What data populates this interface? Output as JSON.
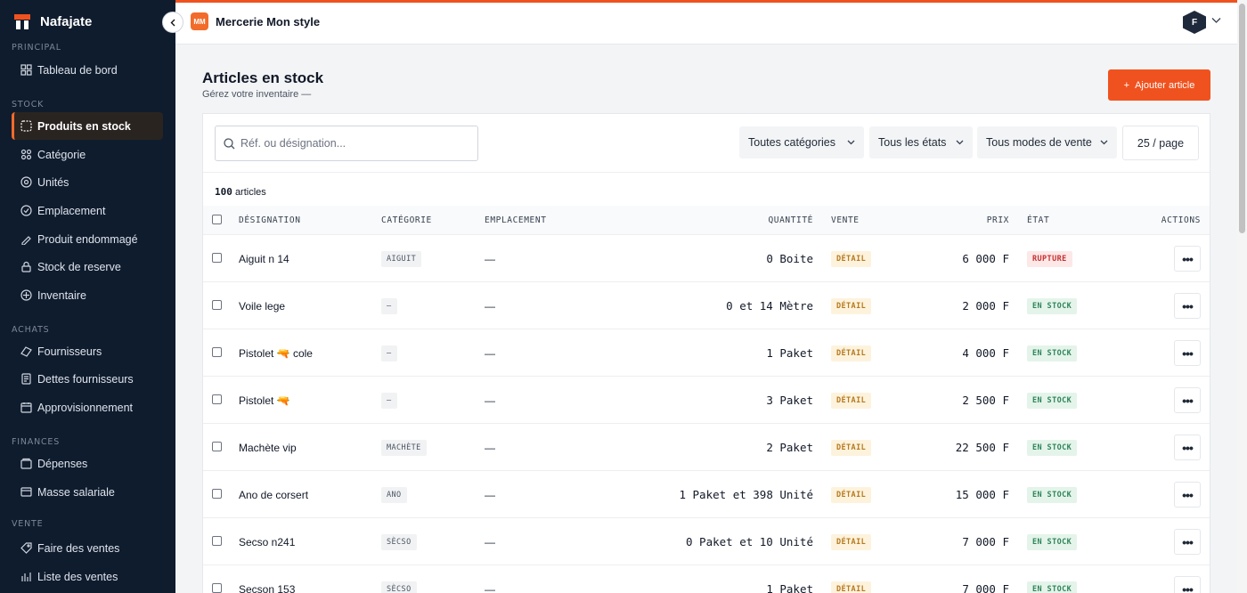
{
  "brand": {
    "name": "Nafajate"
  },
  "sidebar": {
    "sections": [
      {
        "title": "PRINCIPAL"
      },
      {
        "title": "STOCK"
      },
      {
        "title": "ACHATS"
      },
      {
        "title": "FINANCES"
      },
      {
        "title": "VENTE"
      }
    ],
    "items": [
      {
        "label": "Tableau de bord",
        "icon": "dashboard-icon"
      },
      {
        "label": "Produits en stock",
        "icon": "box-icon",
        "active": true
      },
      {
        "label": "Catégorie",
        "icon": "category-icon"
      },
      {
        "label": "Unités",
        "icon": "units-icon"
      },
      {
        "label": "Emplacement",
        "icon": "location-icon"
      },
      {
        "label": "Produit endommagé",
        "icon": "damaged-icon"
      },
      {
        "label": "Stock de reserve",
        "icon": "lock-icon"
      },
      {
        "label": "Inventaire",
        "icon": "inventory-icon"
      },
      {
        "label": "Fournisseurs",
        "icon": "truck-icon"
      },
      {
        "label": "Dettes fournisseurs",
        "icon": "document-icon"
      },
      {
        "label": "Approvisionnement",
        "icon": "calendar-icon"
      },
      {
        "label": "Dépenses",
        "icon": "wallet-icon"
      },
      {
        "label": "Masse salariale",
        "icon": "payroll-icon"
      },
      {
        "label": "Faire des ventes",
        "icon": "tag-icon"
      },
      {
        "label": "Liste des ventes",
        "icon": "chart-icon"
      }
    ]
  },
  "topbar": {
    "shop_logo": "MM",
    "shop_name": "Mercerie Mon style",
    "user_initial": "F"
  },
  "page": {
    "title": "Articles en stock",
    "subtitle": "Gérez votre inventaire —",
    "add_label": "Ajouter article"
  },
  "filters": {
    "search_placeholder": "Réf. ou désignation...",
    "category": "Toutes catégories",
    "state": "Tous les états",
    "mode": "Tous modes de vente",
    "pagesize": "25 / page"
  },
  "count": {
    "number": "100",
    "label": "articles"
  },
  "table": {
    "headers": {
      "designation": "DÉSIGNATION",
      "categorie": "CATÉGORIE",
      "emplacement": "EMPLACEMENT",
      "quantite": "QUANTITÉ",
      "vente": "VENTE",
      "prix": "PRIX",
      "etat": "ÉTAT",
      "actions": "ACTIONS"
    },
    "rows": [
      {
        "name": "Aiguit n 14",
        "category": "AIGUIT",
        "location": "—",
        "qty": "0 Boite",
        "vente": "DÉTAIL",
        "price": "6 000 F",
        "state": "RUPTURE",
        "state_type": "ko"
      },
      {
        "name": "Voile lege",
        "category": "—",
        "location": "—",
        "qty": "0 et 14 Mètre",
        "vente": "DÉTAIL",
        "price": "2 000 F",
        "state": "EN STOCK",
        "state_type": "ok"
      },
      {
        "name": "Pistolet 🔫 cole",
        "category": "—",
        "location": "—",
        "qty": "1 Paket",
        "vente": "DÉTAIL",
        "price": "4 000 F",
        "state": "EN STOCK",
        "state_type": "ok"
      },
      {
        "name": "Pistolet 🔫",
        "category": "—",
        "location": "—",
        "qty": "3 Paket",
        "vente": "DÉTAIL",
        "price": "2 500 F",
        "state": "EN STOCK",
        "state_type": "ok"
      },
      {
        "name": "Machète vip",
        "category": "MACHÈTE",
        "location": "—",
        "qty": "2 Paket",
        "vente": "DÉTAIL",
        "price": "22 500 F",
        "state": "EN STOCK",
        "state_type": "ok"
      },
      {
        "name": "Ano de corsert",
        "category": "ANO",
        "location": "—",
        "qty": "1 Paket et 398 Unité",
        "vente": "DÉTAIL",
        "price": "15 000 F",
        "state": "EN STOCK",
        "state_type": "ok"
      },
      {
        "name": "Secso n241",
        "category": "SÈCSO",
        "location": "—",
        "qty": "0 Paket et 10 Unité",
        "vente": "DÉTAIL",
        "price": "7 000 F",
        "state": "EN STOCK",
        "state_type": "ok"
      },
      {
        "name": "Secson 153",
        "category": "SÈCSO",
        "location": "—",
        "qty": "1 Paket",
        "vente": "DÉTAIL",
        "price": "7 000 F",
        "state": "EN STOCK",
        "state_type": "ok"
      }
    ]
  }
}
